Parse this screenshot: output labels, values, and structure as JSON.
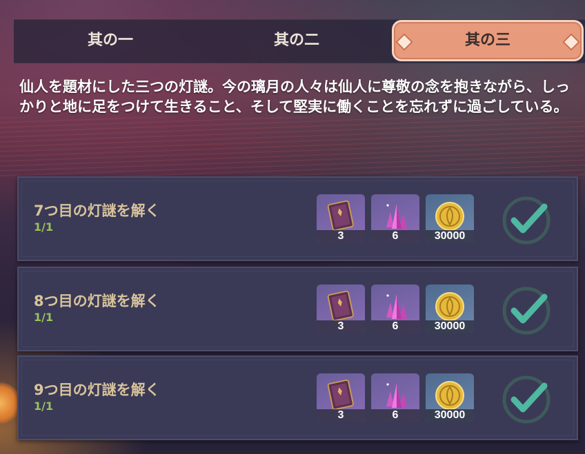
{
  "tabs": [
    {
      "label": "其の一",
      "active": false
    },
    {
      "label": "其の二",
      "active": false
    },
    {
      "label": "其の三",
      "active": true
    }
  ],
  "description": "仙人を題材にした三つの灯謎。今の璃月の人々は仙人に尊敬の念を抱きながら、しっかりと地に足をつけて生きること、そして堅実に働くことを忘れずに過ごしている。",
  "tasks": [
    {
      "title": "7つ目の灯謎を解く",
      "progress": "1/1",
      "rewards": [
        {
          "icon": "book-icon",
          "count": "3"
        },
        {
          "icon": "crystal-icon",
          "count": "6"
        },
        {
          "icon": "mora-coin-icon",
          "count": "30000"
        }
      ],
      "completed": true
    },
    {
      "title": "8つ目の灯謎を解く",
      "progress": "1/1",
      "rewards": [
        {
          "icon": "book-icon",
          "count": "3"
        },
        {
          "icon": "crystal-icon",
          "count": "6"
        },
        {
          "icon": "mora-coin-icon",
          "count": "30000"
        }
      ],
      "completed": true
    },
    {
      "title": "9つ目の灯謎を解く",
      "progress": "1/1",
      "rewards": [
        {
          "icon": "book-icon",
          "count": "3"
        },
        {
          "icon": "crystal-icon",
          "count": "6"
        },
        {
          "icon": "mora-coin-icon",
          "count": "30000"
        }
      ],
      "completed": true
    }
  ],
  "colors": {
    "active_tab": "#e89a7c",
    "task_title": "#d9c49b",
    "progress": "#9bc25a",
    "check": "#4fb8a0"
  }
}
